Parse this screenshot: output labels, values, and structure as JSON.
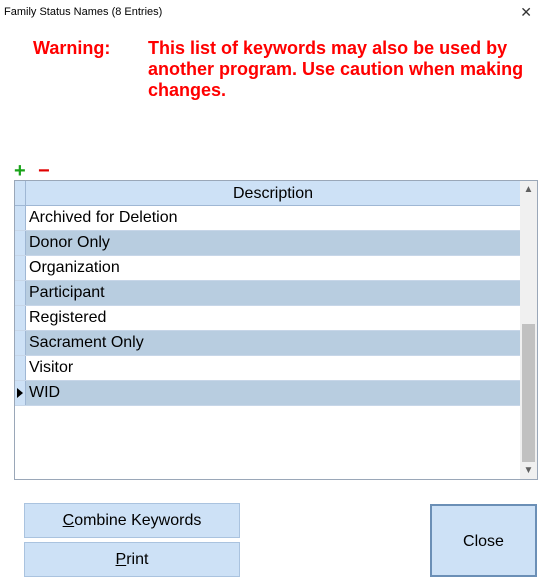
{
  "window": {
    "title": "Family Status Names (8 Entries)",
    "close_glyph": "✕"
  },
  "warning": {
    "label": "Warning:",
    "text": "This list of keywords may also be used by another program. Use caution when making changes."
  },
  "toolbar": {
    "add_glyph": "+",
    "remove_glyph": "−"
  },
  "grid": {
    "column_header": "Description",
    "rows": [
      "Archived for Deletion",
      "Donor Only",
      "Organization",
      "Participant",
      "Registered",
      "Sacrament Only",
      "Visitor",
      "WID"
    ],
    "current_row": "WID"
  },
  "buttons": {
    "combine_first": "C",
    "combine_rest": "ombine Keywords",
    "print_first": "P",
    "print_rest": "rint",
    "close": "Close"
  },
  "colors": {
    "warning": "#ff0000",
    "add": "#1aa31a",
    "remove": "#e00000",
    "row_alt": "#b8cde0",
    "header": "#cde1f6"
  }
}
